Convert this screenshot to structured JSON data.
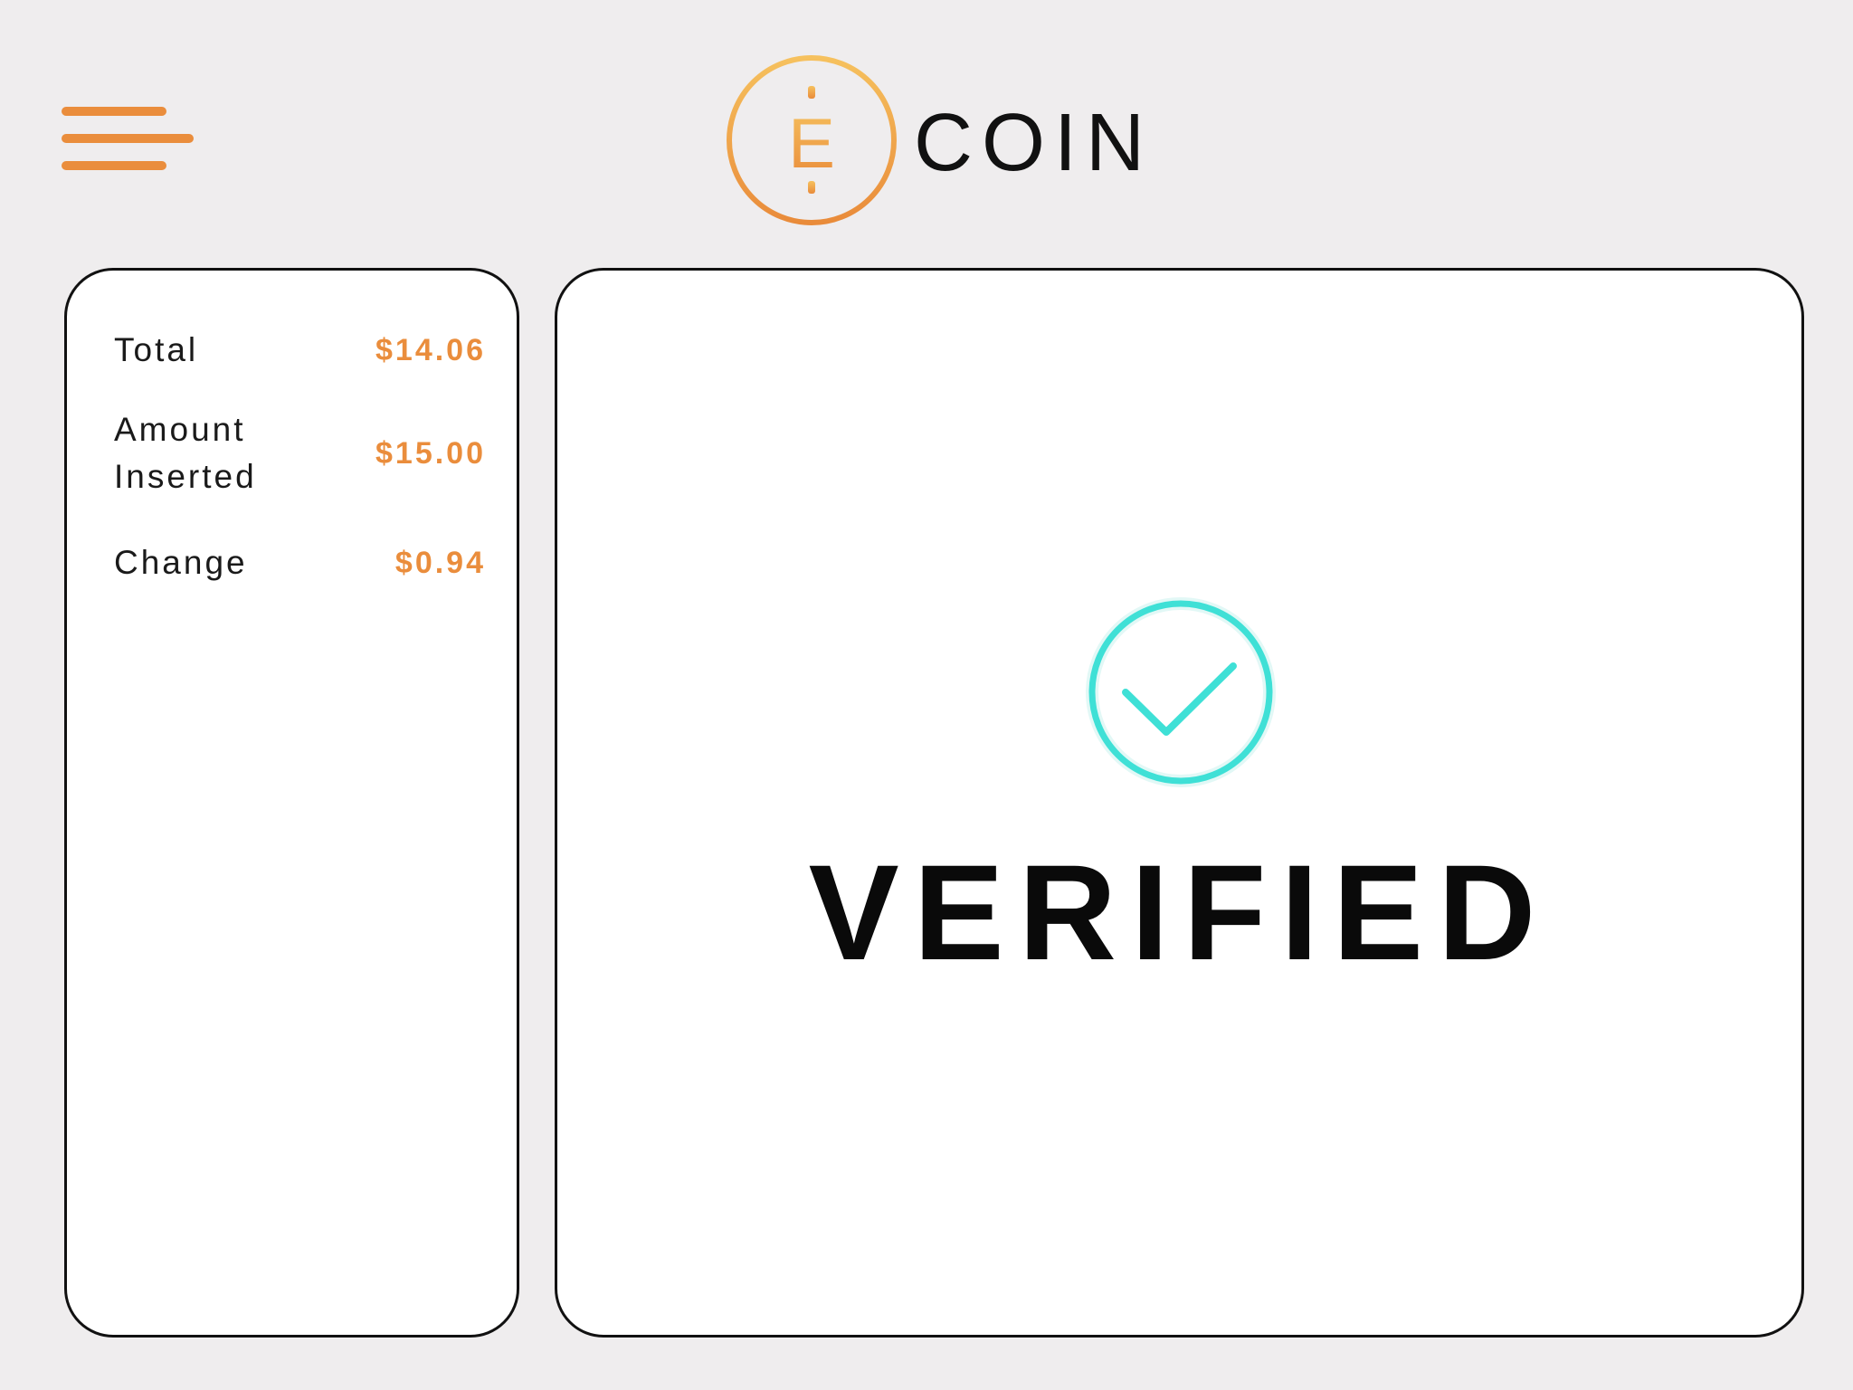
{
  "header": {
    "brand_name": "COIN",
    "logo_letter": "E",
    "menu_icon": "hamburger-menu-icon",
    "logo_icon": "ecoin-logo-icon"
  },
  "summary": {
    "rows": [
      {
        "label": "Total",
        "value": "$14.06"
      },
      {
        "label": "Amount Inserted",
        "value": "$15.00"
      },
      {
        "label": "Change",
        "value": "$0.94"
      }
    ]
  },
  "status": {
    "icon": "check-circle-icon",
    "text": "VERIFIED"
  },
  "colors": {
    "background": "#efedee",
    "accent_orange": "#ea8d3c",
    "accent_gold": "#f6c15e",
    "success_teal": "#3fe0d6",
    "panel_border": "#111111"
  }
}
